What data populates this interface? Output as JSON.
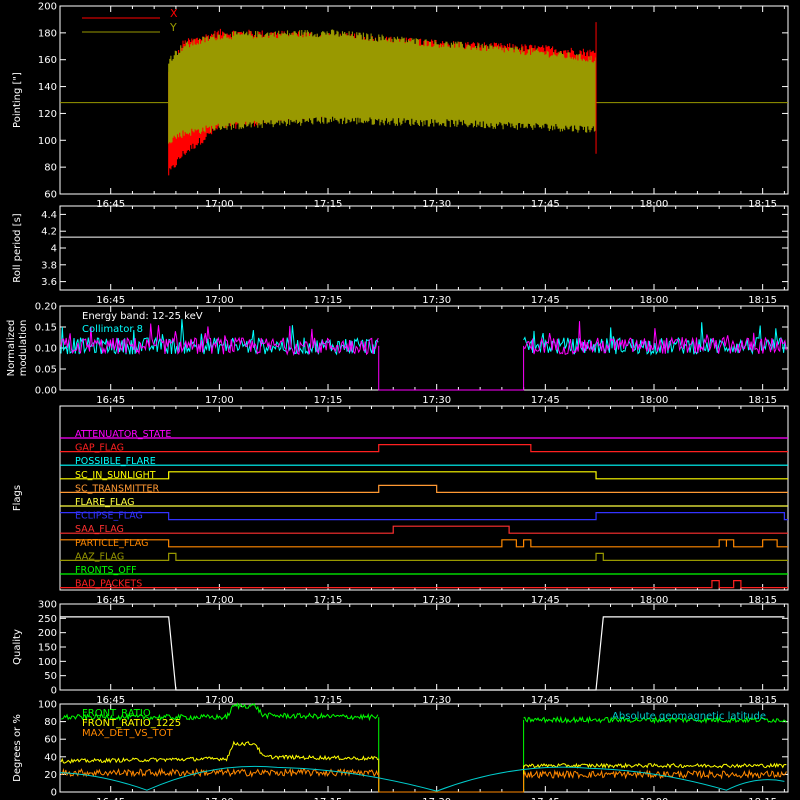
{
  "time_ticks": [
    "16:45",
    "17:00",
    "17:15",
    "17:30",
    "17:45",
    "18:00",
    "18:15"
  ],
  "chart_data": [
    {
      "type": "line",
      "ylabel": "Pointing [\"]",
      "ylim": [
        60,
        200
      ],
      "yticks": [
        60,
        80,
        100,
        120,
        140,
        160,
        180,
        200
      ],
      "legend": [
        {
          "name": "X",
          "color": "#ff0000"
        },
        {
          "name": "Y",
          "color": "#999900"
        }
      ],
      "data_start": "16:53",
      "data_end": "17:52",
      "baseline": 128,
      "series": [
        {
          "name": "X",
          "color": "#ff0000",
          "envelope_time": [
            "16:53",
            "16:55",
            "17:00",
            "17:15",
            "17:30",
            "17:45",
            "17:52"
          ],
          "upper": [
            150,
            172,
            180,
            178,
            172,
            168,
            165
          ],
          "lower": [
            75,
            90,
            110,
            120,
            130,
            140,
            145
          ]
        },
        {
          "name": "Y",
          "color": "#999900",
          "envelope_time": [
            "16:53",
            "16:55",
            "17:00",
            "17:15",
            "17:30",
            "17:45",
            "17:52"
          ],
          "upper": [
            160,
            170,
            178,
            180,
            172,
            165,
            160
          ],
          "lower": [
            100,
            105,
            110,
            115,
            113,
            110,
            108
          ]
        }
      ]
    },
    {
      "type": "line",
      "ylabel": "Roll period [s]",
      "ylim": [
        3.5,
        4.5
      ],
      "yticks": [
        3.6,
        3.8,
        4.0,
        4.2,
        4.4
      ],
      "value": 4.13
    },
    {
      "type": "line",
      "ylabel": "Normalized modulation",
      "ylim": [
        0,
        0.2
      ],
      "yticks": [
        "0.00",
        "0.05",
        "0.10",
        "0.15",
        "0.20"
      ],
      "annotations": [
        "Energy band: 12-25 keV",
        "Collimator 8"
      ],
      "gap": [
        "17:22",
        "17:42"
      ],
      "mean": 0.105,
      "series": [
        {
          "name": "Collimator 8",
          "color": "#00ffff"
        },
        {
          "name": "",
          "color": "#ff00ff"
        }
      ]
    },
    {
      "type": "step",
      "ylabel": "Flags",
      "flags": [
        {
          "name": "ATTENUATOR_STATE",
          "color": "#ff00ff",
          "on": []
        },
        {
          "name": "GAP_FLAG",
          "color": "#ff2020",
          "on": [
            [
              "17:22",
              "17:43"
            ]
          ]
        },
        {
          "name": "POSSIBLE_FLARE",
          "color": "#00ffff",
          "on": []
        },
        {
          "name": "SC_IN_SUNLIGHT",
          "color": "#ffff00",
          "on": [
            [
              "16:53",
              "17:52"
            ]
          ]
        },
        {
          "name": "SC_TRANSMITTER",
          "color": "#ff9933",
          "on": [
            [
              "17:22",
              "17:30"
            ]
          ]
        },
        {
          "name": "FLARE_FLAG",
          "color": "#ffff40",
          "on": []
        },
        {
          "name": "ECLIPSE_FLAG",
          "color": "#3333ff",
          "on": [
            [
              "16:38",
              "16:53"
            ],
            [
              "17:52",
              "18:18"
            ]
          ]
        },
        {
          "name": "SAA_FLAG",
          "color": "#ff3030",
          "on": [
            [
              "17:24",
              "17:40"
            ]
          ]
        },
        {
          "name": "PARTICLE_FLAG",
          "color": "#ff8800",
          "on": [
            [
              "16:38",
              "16:53"
            ],
            [
              "17:39",
              "17:41"
            ],
            [
              "17:42",
              "17:43"
            ],
            [
              "18:09",
              "18:10"
            ],
            [
              "18:10",
              "18:11"
            ],
            [
              "18:15",
              "18:17"
            ]
          ]
        },
        {
          "name": "AAZ_FLAG",
          "color": "#999900",
          "on": [
            [
              "16:53",
              "16:54"
            ],
            [
              "17:52",
              "17:53"
            ]
          ]
        },
        {
          "name": "FRONTS_OFF",
          "color": "#00ff00",
          "on": []
        },
        {
          "name": "BAD_PACKETS",
          "color": "#ff2020",
          "on": [
            [
              "18:08",
              "18:09"
            ],
            [
              "18:11",
              "18:12"
            ]
          ]
        }
      ]
    },
    {
      "type": "line",
      "ylabel": "Quality",
      "ylim": [
        0,
        300
      ],
      "yticks": [
        0,
        50,
        100,
        150,
        200,
        250,
        300
      ],
      "x": [
        "16:38",
        "16:53",
        "16:54",
        "17:52",
        "17:53",
        "18:18"
      ],
      "values": [
        255,
        255,
        0,
        0,
        255,
        255
      ]
    },
    {
      "type": "line",
      "ylabel": "Degrees or %",
      "ylim": [
        0,
        100
      ],
      "yticks": [
        0,
        20,
        40,
        60,
        80,
        100
      ],
      "gap": [
        "17:22",
        "17:42"
      ],
      "annotations_right": [
        "Absolute geomagnetic latitude"
      ],
      "series": [
        {
          "name": "FRONT_RATIO",
          "color": "#00ff00",
          "x": [
            "16:38",
            "17:01",
            "17:02",
            "17:05",
            "17:06",
            "17:22"
          ],
          "values": [
            85,
            85,
            98,
            98,
            87,
            85
          ]
        },
        {
          "name": "FRONT_RATIO_1225",
          "color": "#ffff00",
          "x": [
            "16:38",
            "17:01",
            "17:02",
            "17:05",
            "17:06",
            "17:22"
          ],
          "values": [
            35,
            38,
            55,
            55,
            40,
            38
          ]
        },
        {
          "name": "MAX_DET_VS_TOT",
          "color": "#ff8800",
          "x": [
            "16:38",
            "17:22"
          ],
          "values": [
            22,
            22
          ]
        },
        {
          "name": "Absolute geomagnetic latitude",
          "color": "#00cccc",
          "x": [
            "16:38",
            "16:50",
            "17:08",
            "17:30",
            "17:51",
            "18:10",
            "18:18"
          ],
          "values": [
            22,
            2,
            28,
            1,
            27,
            2,
            12
          ]
        }
      ]
    }
  ]
}
